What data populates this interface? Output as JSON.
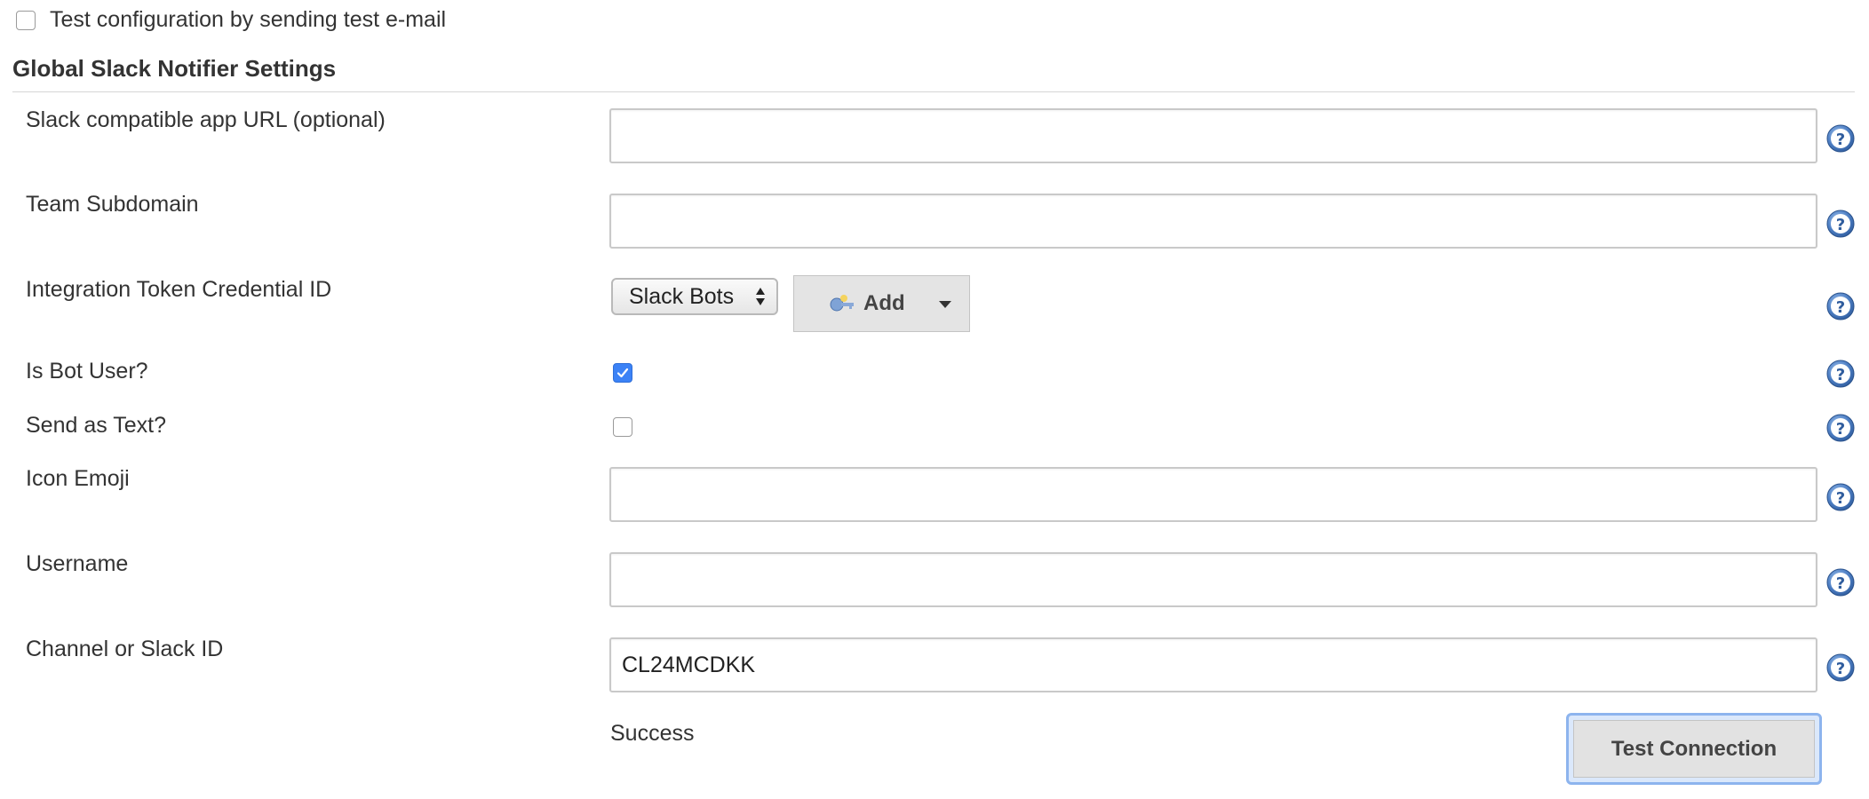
{
  "top": {
    "test_mail_label": "Test configuration by sending test e-mail",
    "test_mail_checked": false
  },
  "section": {
    "title": "Global Slack Notifier Settings"
  },
  "fields": {
    "app_url": {
      "label": "Slack compatible app URL (optional)",
      "value": ""
    },
    "team_subdomain": {
      "label": "Team Subdomain",
      "value": ""
    },
    "credential": {
      "label": "Integration Token Credential ID",
      "selected": "Slack Bots",
      "add_label": "Add"
    },
    "bot_user": {
      "label": "Is Bot User?",
      "checked": true
    },
    "send_as_text": {
      "label": "Send as Text?",
      "checked": false
    },
    "icon_emoji": {
      "label": "Icon Emoji",
      "value": ""
    },
    "username": {
      "label": "Username",
      "value": ""
    },
    "channel": {
      "label": "Channel or Slack ID",
      "value": "CL24MCDKK"
    }
  },
  "status": {
    "text": "Success"
  },
  "buttons": {
    "test_connection": "Test Connection"
  },
  "icons": {
    "help": "question-mark-help-icon",
    "add": "key-icon"
  },
  "colors": {
    "help_blue": "#3b6fb6",
    "checkbox_checked": "#3b82f6",
    "focus_ring": "#8db4ee"
  }
}
